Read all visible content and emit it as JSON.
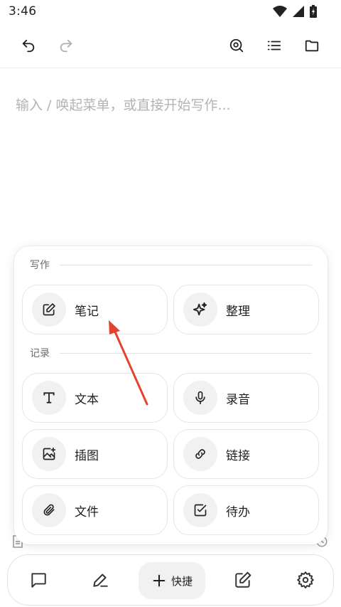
{
  "status": {
    "time": "3:46"
  },
  "editor": {
    "placeholder": "输入 / 唤起菜单，或直接开始写作..."
  },
  "menu": {
    "sections": [
      {
        "label": "写作",
        "items": [
          "笔记",
          "整理"
        ]
      },
      {
        "label": "记录",
        "items": [
          "文本",
          "录音",
          "插图",
          "链接",
          "文件",
          "待办"
        ]
      }
    ]
  },
  "bottom_bar": {
    "quick_label": "快捷"
  },
  "colors": {
    "annotation_arrow": "#e5432f"
  },
  "icons": [
    "undo-icon",
    "redo-icon",
    "search-icon",
    "list-icon",
    "folder-icon",
    "edit-note-icon",
    "sparkle-icon",
    "text-icon",
    "mic-icon",
    "image-add-icon",
    "link-icon",
    "paperclip-icon",
    "checkbox-icon",
    "chat-icon",
    "pen-icon",
    "plus-icon",
    "compose-icon",
    "gear-icon"
  ]
}
